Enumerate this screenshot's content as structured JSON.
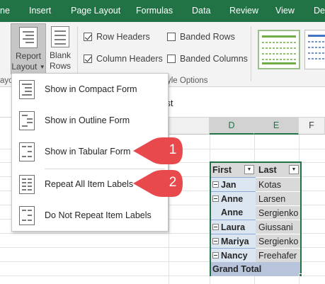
{
  "tabs": [
    "ne",
    "Insert",
    "Page Layout",
    "Formulas",
    "Data",
    "Review",
    "View",
    "De"
  ],
  "ribbon": {
    "report_layout_line1": "Report",
    "report_layout_line2": "Layout",
    "blank_rows_line1": "Blank",
    "blank_rows_line2": "Rows",
    "row_headers": "Row Headers",
    "column_headers": "Column Headers",
    "banded_rows": "Banded Rows",
    "banded_columns": "Banded Columns",
    "row_headers_checked": true,
    "column_headers_checked": true,
    "banded_rows_checked": false,
    "banded_columns_checked": false,
    "group_label_left": "ayo",
    "group_label_style_options": "yle Options",
    "accent_color": "#217346"
  },
  "formula_bar": {
    "text": "rst"
  },
  "columns": [
    "D",
    "E",
    "F"
  ],
  "menu": {
    "items": [
      {
        "label": "Show in Compact Form",
        "icon": "compact-form-icon"
      },
      {
        "label": "Show in Outline Form",
        "icon": "outline-form-icon"
      },
      {
        "label": "Show in Tabular Form",
        "icon": "tabular-form-icon"
      },
      {
        "label": "Repeat All Item Labels",
        "icon": "repeat-labels-icon"
      },
      {
        "label": "Do Not Repeat Item Labels",
        "icon": "no-repeat-labels-icon"
      }
    ]
  },
  "callouts": [
    {
      "number": "1",
      "color": "#e8494d"
    },
    {
      "number": "2",
      "color": "#e8494d"
    }
  ],
  "pivot": {
    "header_first": "First",
    "header_last": "Last",
    "rows": [
      {
        "first": "Jan",
        "last": "Kotas"
      },
      {
        "first": "Anne",
        "last": "Larsen"
      },
      {
        "first": "Anne",
        "last": "Sergienko"
      },
      {
        "first": "Laura",
        "last": "Giussani"
      },
      {
        "first": "Mariya",
        "last": "Sergienko"
      },
      {
        "first": "Nancy",
        "last": "Freehafer"
      }
    ],
    "grand_total": "Grand Total"
  }
}
